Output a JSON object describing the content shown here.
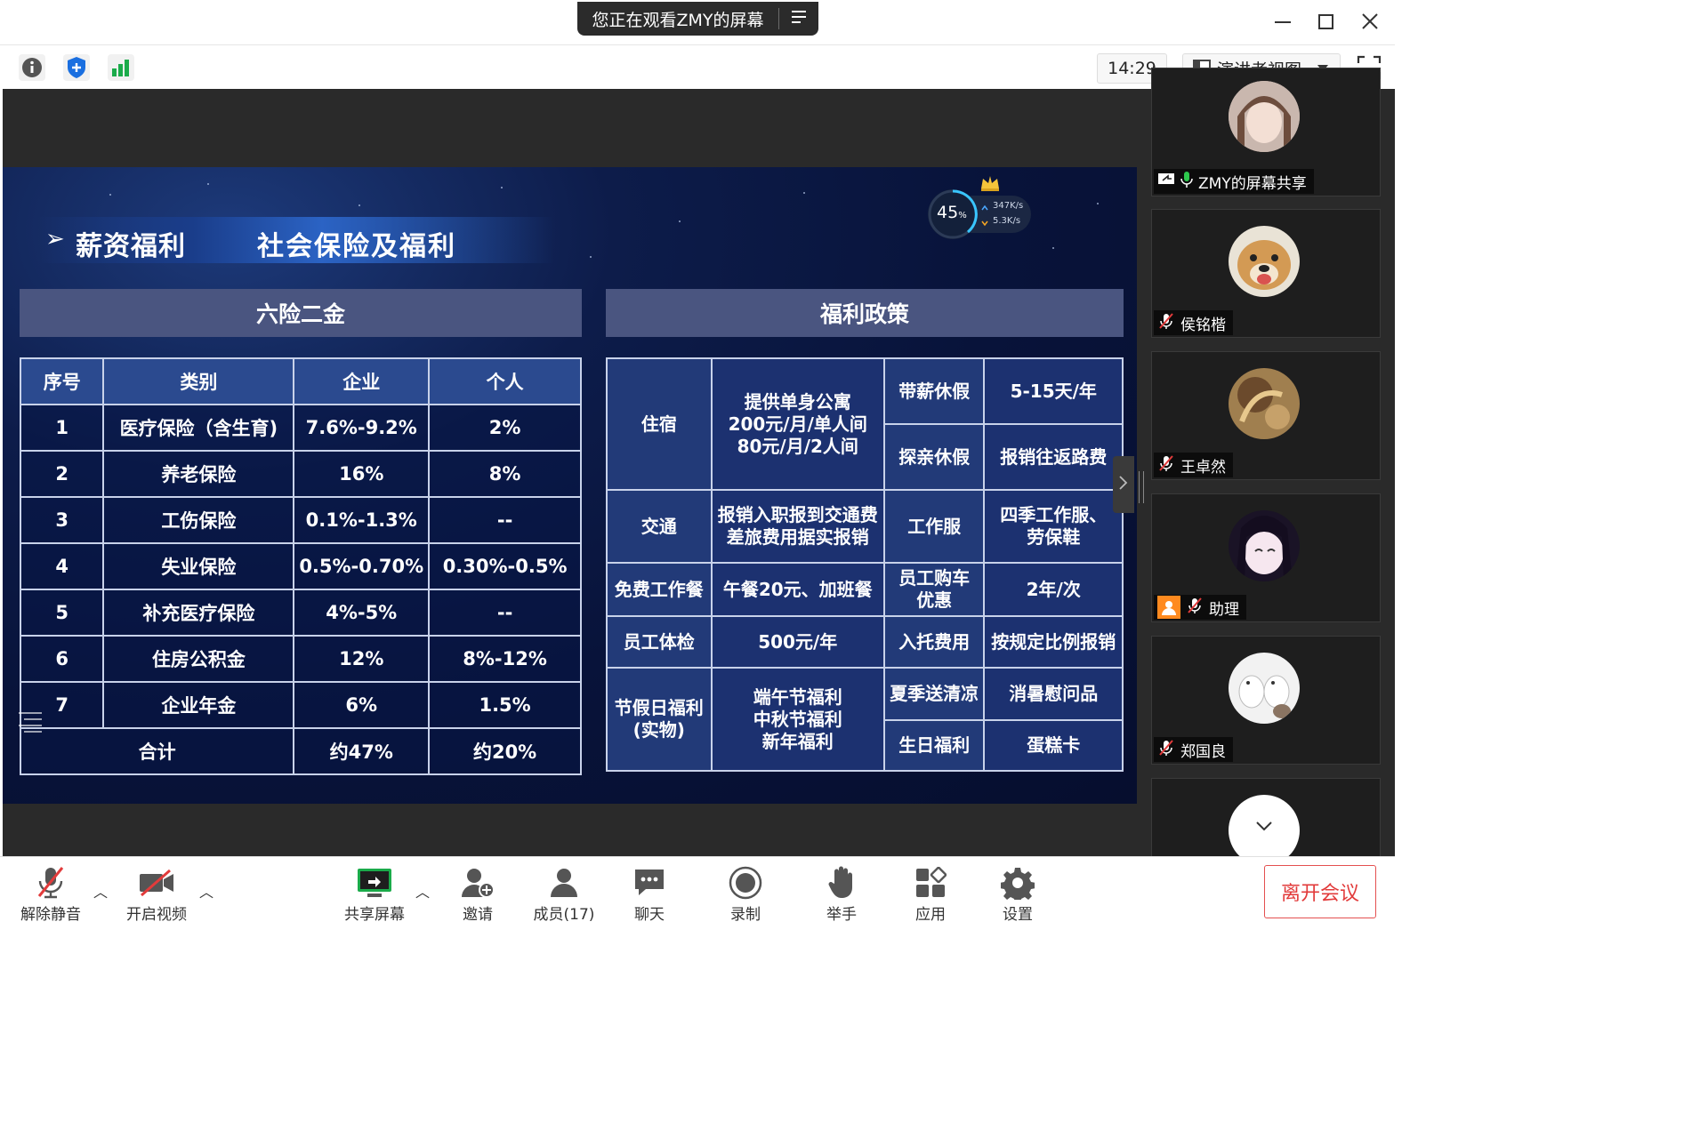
{
  "window": {
    "share_banner": "您正在观看ZMY的屏幕"
  },
  "toolbar": {
    "time": "14:29",
    "view_mode": "演讲者视图"
  },
  "slide": {
    "heading_main": "薪资福利",
    "heading_sub": "社会保险及福利",
    "network": {
      "percent": "45",
      "percent_unit": "%",
      "up": "347K/s",
      "down": "5.3K/s"
    },
    "left_section_title": "六险二金",
    "right_section_title": "福利政策",
    "insurance_table": {
      "headers": [
        "序号",
        "类别",
        "企业",
        "个人"
      ],
      "rows": [
        [
          "1",
          "医疗保险（含生育)",
          "7.6%-9.2%",
          "2%"
        ],
        [
          "2",
          "养老保险",
          "16%",
          "8%"
        ],
        [
          "3",
          "工伤保险",
          "0.1%-1.3%",
          "--"
        ],
        [
          "4",
          "失业保险",
          "0.5%-0.70%",
          "0.30%-0.5%"
        ],
        [
          "5",
          "补充医疗保险",
          "4%-5%",
          "--"
        ],
        [
          "6",
          "住房公积金",
          "12%",
          "8%-12%"
        ],
        [
          "7",
          "企业年金",
          "6%",
          "1.5%"
        ]
      ],
      "total": [
        "合计",
        "约47%",
        "约20%"
      ]
    },
    "welfare_table": {
      "lodging_label": "住宿",
      "lodging_line1": "提供单身公寓",
      "lodging_line2": "200元/月/单人间",
      "lodging_line3": "80元/月/2人间",
      "paid_leave_label": "带薪休假",
      "paid_leave_value": "5-15天/年",
      "family_leave_label": "探亲休假",
      "family_leave_value": "报销往返路费",
      "transport_label": "交通",
      "transport_line1": "报销入职报到交通费",
      "transport_line2": "差旅费用据实报销",
      "uniform_label": "工作服",
      "uniform_line1": "四季工作服、",
      "uniform_line2": "劳保鞋",
      "meal_label": "免费工作餐",
      "meal_value": "午餐20元、加班餐",
      "car_label_line1": "员工购车",
      "car_label_line2": "优惠",
      "car_value": "2年/次",
      "checkup_label": "员工体检",
      "checkup_value": "500元/年",
      "childcare_label": "入托费用",
      "childcare_value": "按规定比例报销",
      "holiday_label_line1": "节假日福利",
      "holiday_label_line2": "(实物)",
      "holiday_line1": "端午节福利",
      "holiday_line2": "中秋节福利",
      "holiday_line3": "新年福利",
      "summer_label": "夏季送清凉",
      "summer_value": "消暑慰问品",
      "birthday_label": "生日福利",
      "birthday_value": "蛋糕卡"
    }
  },
  "participants": [
    {
      "name": "ZMY的屏幕共享"
    },
    {
      "name": "侯铭楷"
    },
    {
      "name": "王卓然"
    },
    {
      "name": "助理"
    },
    {
      "name": "郑国良"
    }
  ],
  "bottom": {
    "unmute": "解除静音",
    "start_video": "开启视频",
    "share_screen": "共享屏幕",
    "invite": "邀请",
    "members": "成员(17)",
    "chat": "聊天",
    "record": "录制",
    "raise_hand": "举手",
    "apps": "应用",
    "settings": "设置",
    "leave": "离开会议"
  },
  "colors": {
    "leave_red": "#e23b3b",
    "slide_bg": "#0d1c4a",
    "table_header": "#2b4a8f",
    "share_green": "#1aab4a"
  }
}
